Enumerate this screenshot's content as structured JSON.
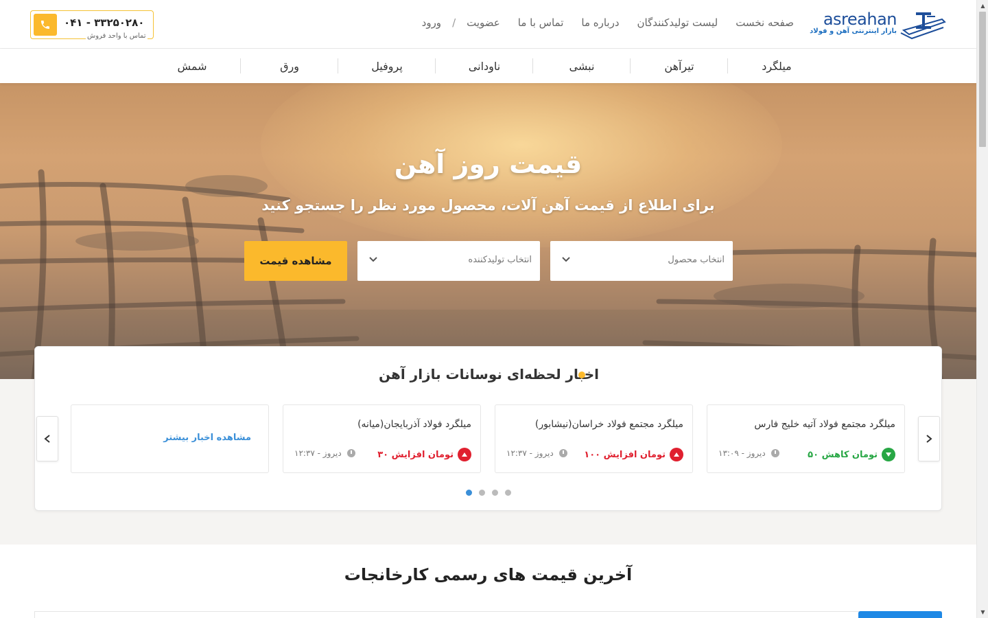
{
  "header": {
    "logo_brand": "asreahan",
    "logo_subtitle": "بازار اینترنتی آهن و فولاد",
    "nav": {
      "home": "صفحه نخست",
      "producers": "لیست تولیدکنندگان",
      "about": "درباره ما",
      "contact": "تماس با ما",
      "register": "عضویت",
      "separator": "/",
      "login": "ورود"
    },
    "phone": {
      "number": "۰۴۱ - ۳۳۲۵۰۲۸۰",
      "caption": "تماس با واحد فروش"
    }
  },
  "categories": [
    "میلگرد",
    "تیرآهن",
    "نبشی",
    "ناودانی",
    "پروفیل",
    "ورق",
    "شمش"
  ],
  "hero": {
    "title": "قیمت روز آهن",
    "subtitle": "برای اطلاع از قیمت آهن آلات، محصول مورد نظر را جستجو کنید",
    "product_placeholder": "انتخاب محصول",
    "producer_placeholder": "انتخاب تولیدکننده",
    "button_label": "مشاهده قیمت"
  },
  "news": {
    "title": "اخبار لحظه‌ای نوسانات بازار آهن",
    "items": [
      {
        "title": "میلگرد مجتمع فولاد آتیه خلیج فارس",
        "change": "۵۰ تومان کاهش",
        "direction": "down",
        "time": "۱۳:۰۹ - دیروز"
      },
      {
        "title": "میلگرد مجتمع فولاد خراسان(نیشابور)",
        "change": "۱۰۰ تومان افزایش",
        "direction": "up",
        "time": "۱۲:۳۷ - دیروز"
      },
      {
        "title": "میلگرد فولاد آذربایجان(میانه)",
        "change": "۳۰ تومان افزایش",
        "direction": "up",
        "time": "۱۲:۳۷ - دیروز"
      }
    ],
    "more_label": "مشاهده اخبار بیشتر",
    "page_count": 4,
    "active_page": 1
  },
  "prices": {
    "title": "آخرین قیمت های رسمی کارخانجات"
  },
  "colors": {
    "accent": "#fbb92c",
    "link": "#3a8fd8",
    "increase": "#e0202f",
    "decrease": "#28a745"
  }
}
